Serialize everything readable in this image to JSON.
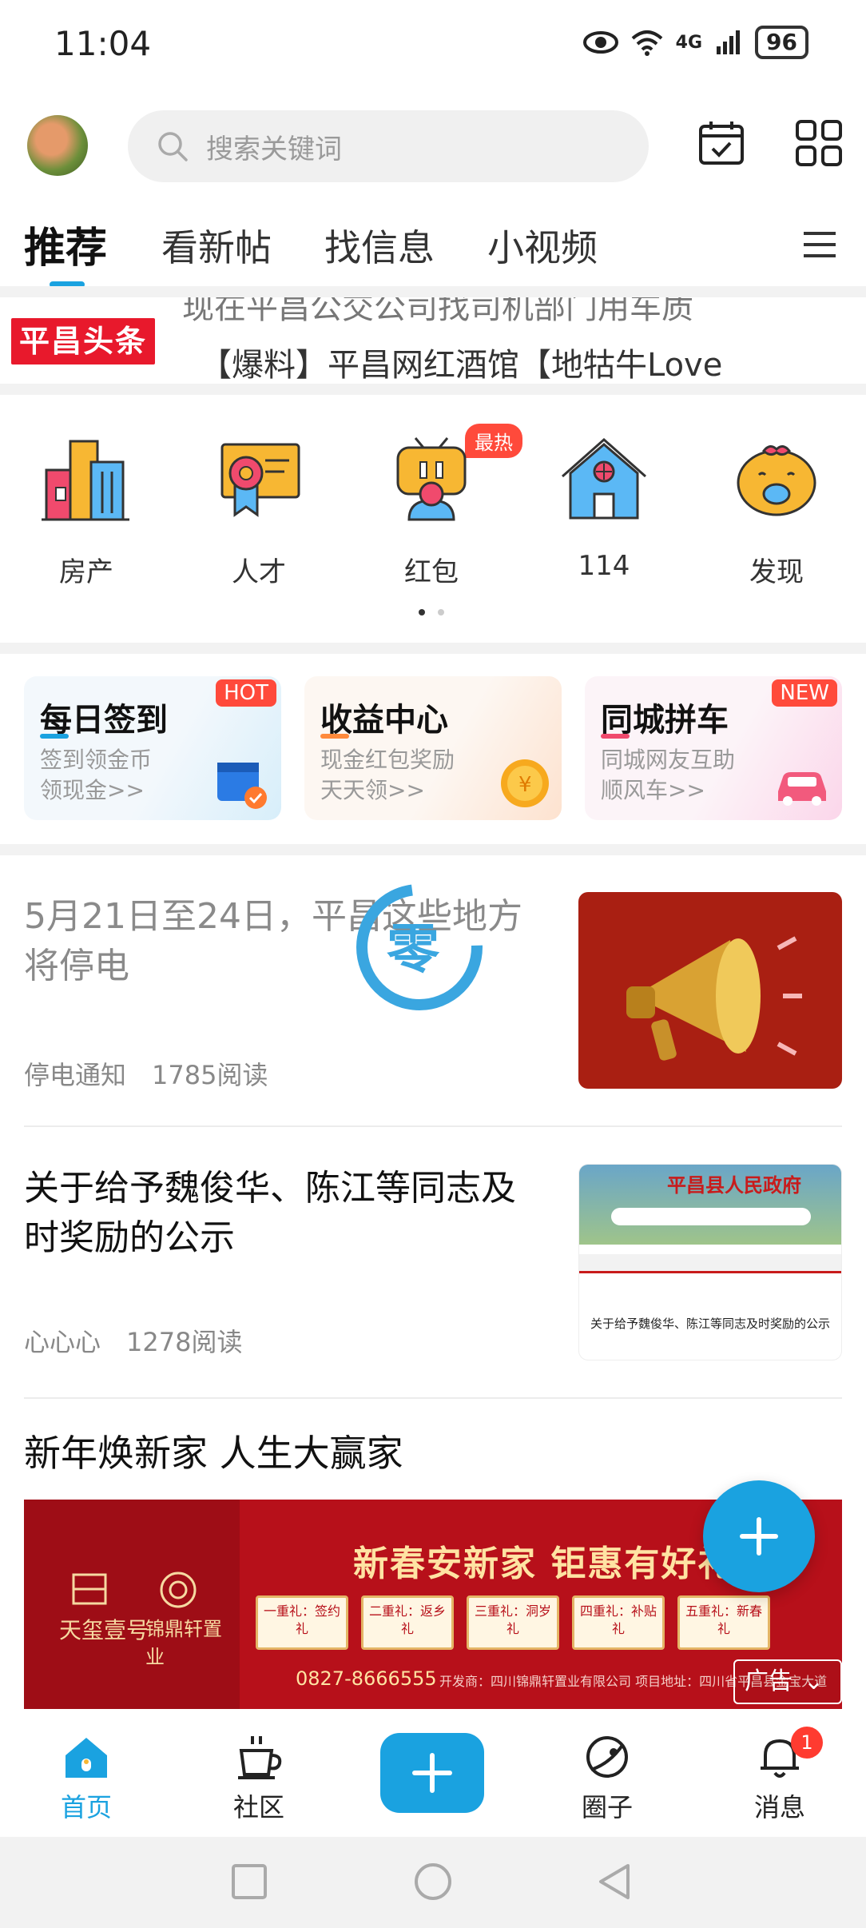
{
  "status": {
    "time": "11:04",
    "battery": "96",
    "net": "4G"
  },
  "search": {
    "placeholder": "搜索关键词"
  },
  "tabs": [
    "推荐",
    "看新帖",
    "找信息",
    "小视频"
  ],
  "ticker": {
    "logo": "平昌头条",
    "line_top": "现在平昌公交公司找司机部门用车质",
    "line_bottom": "【爆料】平昌网红酒馆【地牯牛Love"
  },
  "categories": [
    {
      "label": "房产",
      "icon": "building-icon"
    },
    {
      "label": "人才",
      "icon": "certificate-icon"
    },
    {
      "label": "红包",
      "icon": "red-envelope-icon"
    },
    {
      "label": "114",
      "icon": "house-icon"
    },
    {
      "label": "发现",
      "icon": "pig-icon"
    }
  ],
  "hot_badge": "最热",
  "cards": [
    {
      "title": "每日签到",
      "sub1": "签到领金币",
      "sub2": "领现金>>",
      "badge": "HOT"
    },
    {
      "title": "收益中心",
      "sub1": "现金红包奖励",
      "sub2": "天天领>>",
      "badge": ""
    },
    {
      "title": "同城拼车",
      "sub1": "同城网友互助",
      "sub2": "顺风车>>",
      "badge": "NEW"
    }
  ],
  "news": [
    {
      "title": "5月21日至24日，平昌这些地方将停电",
      "source": "停电通知",
      "reads": "1785阅读"
    },
    {
      "title": "关于给予魏俊华、陈江等同志及时奖励的公示",
      "source": "心心心",
      "reads": "1278阅读",
      "thumb_caption": "关于给予魏俊华、陈江等同志及时奖励的公示",
      "thumb_site": "平昌县人民政府"
    }
  ],
  "ad": {
    "title": "新年焕新家 人生大赢家",
    "headline": "新春安新家  钜惠有好礼",
    "brand_left": "天玺壹号",
    "brand_right": "锦鼎轩置业",
    "gifts": [
      "一重礼：签约礼",
      "二重礼：返乡礼",
      "三重礼：洞岁礼",
      "四重礼：补贴礼",
      "五重礼：新春礼"
    ],
    "phone": "0827-8666555",
    "developer": "开发商：四川锦鼎轩置业有限公司  项目地址：四川省平昌县金宝大道",
    "tag": "广告"
  },
  "bottom_nav": [
    {
      "label": "首页",
      "icon": "home-icon"
    },
    {
      "label": "社区",
      "icon": "coffee-cup-icon"
    },
    {
      "label": "圈子",
      "icon": "planet-icon"
    },
    {
      "label": "消息",
      "icon": "bell-icon",
      "badge": "1"
    }
  ],
  "colors": {
    "accent": "#1aa2e0",
    "red": "#e8192c"
  }
}
